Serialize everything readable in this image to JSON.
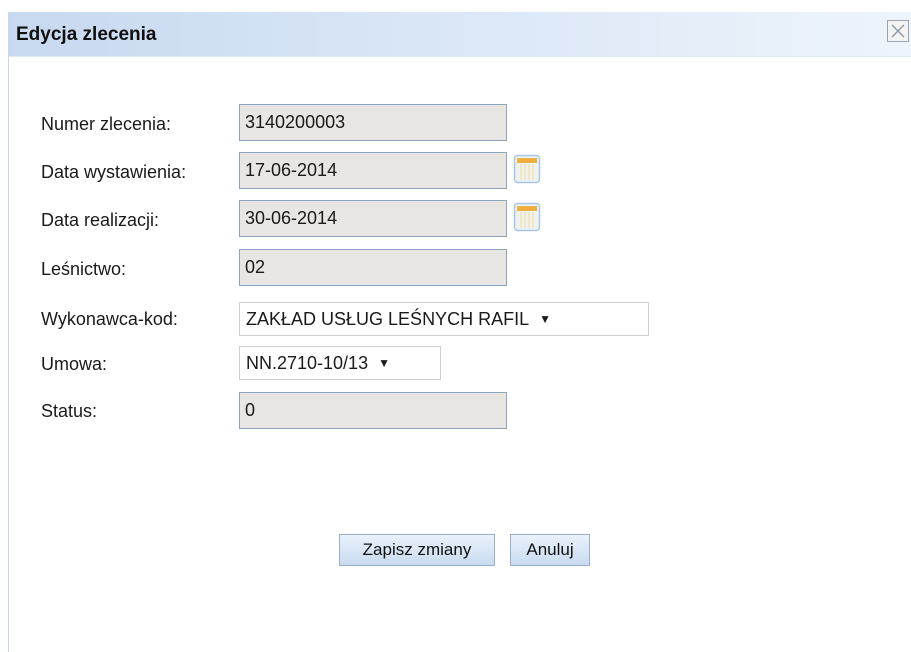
{
  "dialog": {
    "title": "Edycja zlecenia",
    "close_icon": "close-icon"
  },
  "form": {
    "order_number_label": "Numer zlecenia:",
    "order_number_value": "3140200003",
    "issue_date_label": "Data wystawienia:",
    "issue_date_value": "17-06-2014",
    "realization_date_label": "Data realizacji:",
    "realization_date_value": "30-06-2014",
    "forestry_label": "Leśnictwo:",
    "forestry_value": "02",
    "contractor_label": "Wykonawca-kod:",
    "contractor_value": "ZAKŁAD USŁUG LEŚNYCH RAFIL",
    "contract_label": "Umowa:",
    "contract_value": "NN.2710-10/13",
    "status_label": "Status:",
    "status_value": "0",
    "calendar_icon": "calendar-icon"
  },
  "buttons": {
    "save": "Zapisz zmiany",
    "cancel": "Anuluj"
  },
  "colors": {
    "title_gradient_start": "#c7d9f0",
    "field_background": "#e8e6e2",
    "field_border": "#8aa3bf",
    "button_gradient": "#c9dbf0"
  }
}
